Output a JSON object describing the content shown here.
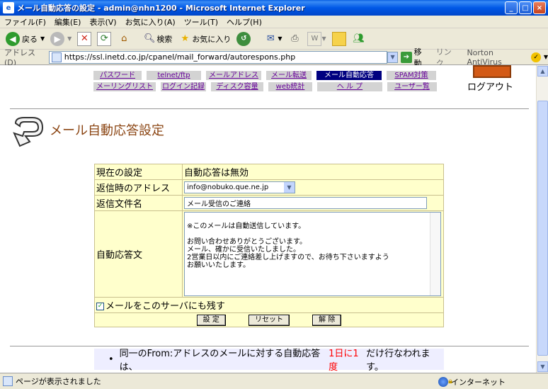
{
  "window": {
    "title": "メール自動応答の設定 - admin@nhn1200 - Microsoft Internet Explorer"
  },
  "menu": [
    "ファイル(F)",
    "編集(E)",
    "表示(V)",
    "お気に入り(A)",
    "ツール(T)",
    "ヘルプ(H)"
  ],
  "toolbar": {
    "back": "戻る",
    "search": "検索",
    "favorites": "お気に入り"
  },
  "address": {
    "label": "アドレス(D)",
    "url": "https://ssl.inetd.co.jp/cpanel/mail_forward/autorespons.php",
    "go": "移動",
    "links": "リンク",
    "norton": "Norton AntiVirus"
  },
  "nav": {
    "row1": [
      "パスワード",
      "telnet/ftp",
      "メールアドレス",
      "メール転送",
      "メール自動応答",
      "SPAM対策"
    ],
    "row2": [
      "メーリングリスト",
      "ログイン記録",
      "ディスク容量",
      "web統計",
      "ヘ ル プ",
      "ユーザー覧"
    ],
    "logout": "ログアウト"
  },
  "page": {
    "title": "メール自動応答設定"
  },
  "form": {
    "current_label": "現在の設定",
    "current_value": "自動応答は無効",
    "reply_addr_label": "返信時のアドレス",
    "reply_addr_value": "info@nobuko.que.ne.jp",
    "subject_label": "返信文件名",
    "subject_value": "メール受信のご連絡",
    "body_label": "自動応答文",
    "body_value": "※このメールは自動送信しています。\n\nお問い合わせありがとうございます。\nメール、確かに受信いたしました。\n2営業日以内にご連絡差し上げますので、お待ち下さいますよう\nお願いいたします。",
    "keep_label": "メールをこのサーバにも残す",
    "keep_checked": true,
    "btn_set": "設 定",
    "btn_reset": "リセット",
    "btn_cancel": "解 除"
  },
  "note": {
    "pre": "同一のFrom:アドレスのメールに対する自動応答は、",
    "red": "1日に1度",
    "post": "だけ行なわれます。"
  },
  "status": {
    "text": "ページが表示されました",
    "zone": "インターネット"
  },
  "colors": {
    "title_bar": "#0058e6",
    "form_bg": "#ffffcc",
    "nav_active": "#000080",
    "page_title": "#8b4513"
  }
}
